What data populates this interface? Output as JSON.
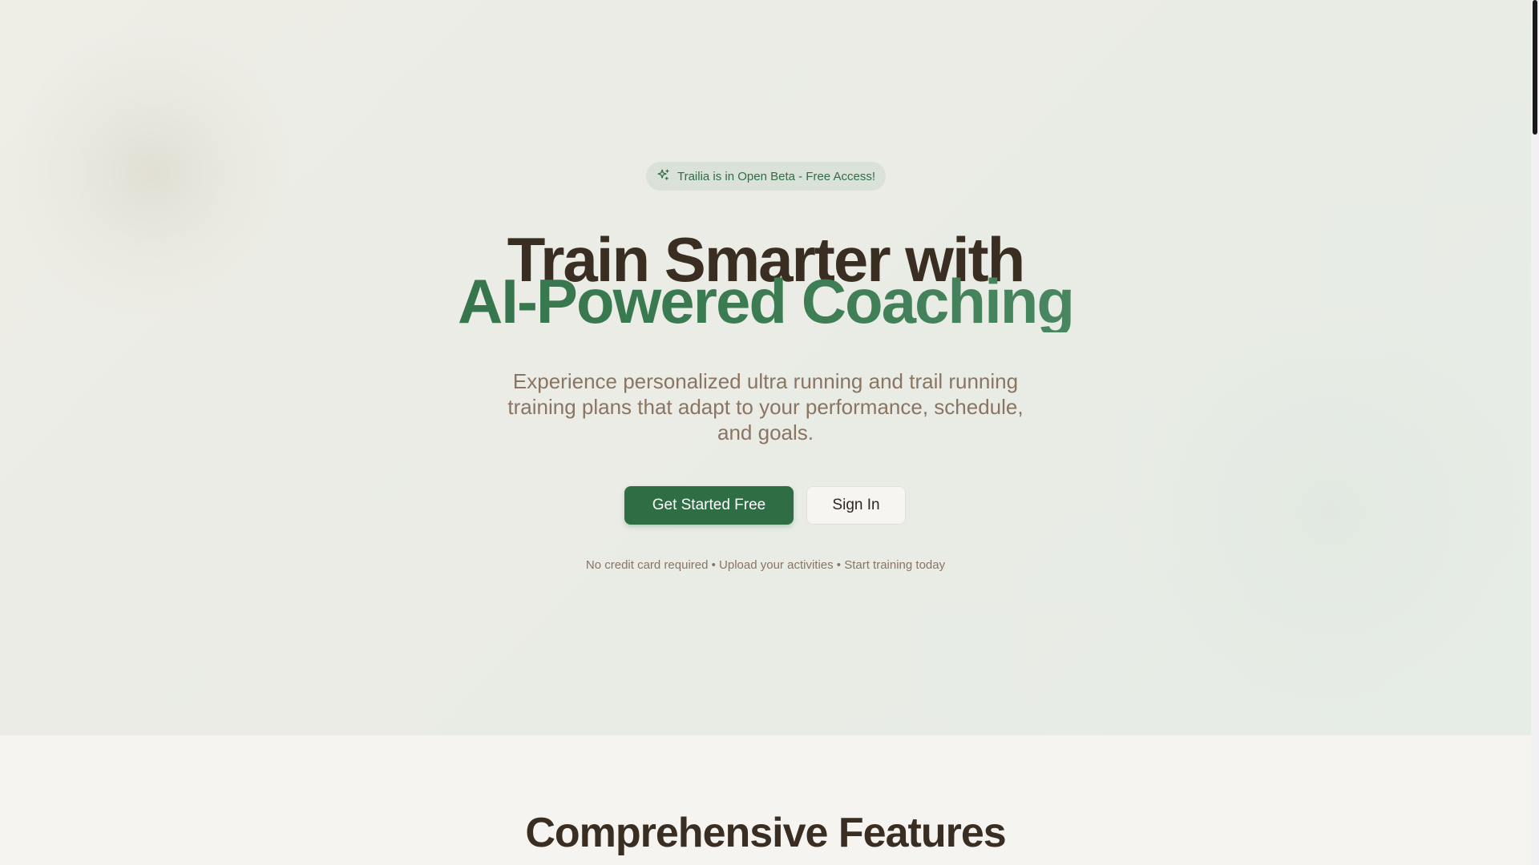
{
  "hero": {
    "badge": {
      "icon": "sparkles-icon",
      "text": "Trailia is in Open Beta - Free Access!"
    },
    "headline_line1": "Train Smarter with",
    "headline_line2": "AI-Powered Coaching",
    "subtitle": "Experience personalized ultra running and trail running training plans that adapt to your performance, schedule, and goals.",
    "primary_cta": "Get Started Free",
    "secondary_cta": "Sign In",
    "fine_print": "No credit card required • Upload your activities • Start training today"
  },
  "features": {
    "title": "Comprehensive Features"
  },
  "colors": {
    "accent": "#2f6e45",
    "heading": "#3a2d22",
    "muted_text": "#8a7462",
    "badge_bg": "#d9e1d8"
  }
}
